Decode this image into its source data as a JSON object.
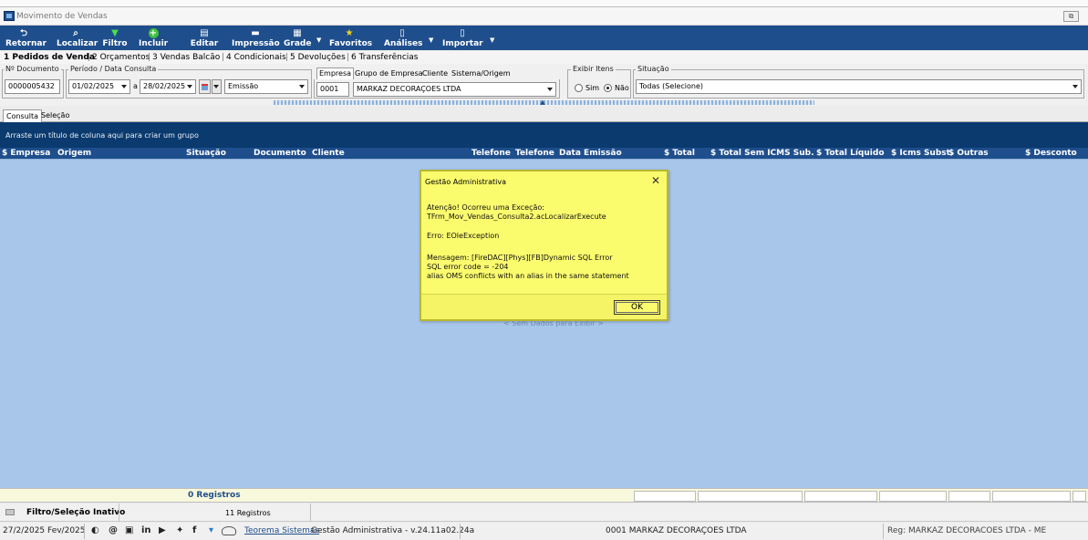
{
  "window": {
    "title": "Movimento de Vendas",
    "restore_glyph": "⧉"
  },
  "toolbar": {
    "buttons": [
      {
        "label": "Retornar",
        "icon": "return-arrow-icon",
        "glyph": "⮌"
      },
      {
        "label": "Localizar",
        "icon": "search-icon",
        "glyph": "⌕"
      },
      {
        "label": "Filtro",
        "icon": "filter-icon",
        "glyph": "▼"
      },
      {
        "label": "Incluir",
        "icon": "add-circle-icon",
        "glyph": "+"
      },
      {
        "label": "Editar",
        "icon": "edit-document-icon",
        "glyph": "▤"
      },
      {
        "label": "Impressão",
        "icon": "printer-icon",
        "glyph": "▬"
      },
      {
        "label": "Grade",
        "icon": "grid-icon",
        "glyph": "▦"
      },
      {
        "label": "Favoritos",
        "icon": "star-icon",
        "glyph": "★"
      },
      {
        "label": "Análises",
        "icon": "document-icon",
        "glyph": "▯"
      },
      {
        "label": "Importar",
        "icon": "document-import-icon",
        "glyph": "▯"
      }
    ],
    "drop_glyph": "▼"
  },
  "module_tabs": [
    "1 Pedidos de Venda",
    "2 Orçamentos",
    "3 Vendas Balcão",
    "4 Condicionais",
    "5 Devoluções",
    "6 Transferências"
  ],
  "module_tab_separator": "|",
  "filters": {
    "documento": {
      "label": "Nº Documento",
      "value": "0000005432"
    },
    "periodo": {
      "label": "Período / Data Consulta",
      "start": "01/02/2025",
      "connector": "a",
      "end": "28/02/2025",
      "type": "Emissão"
    },
    "empresa_tabs": [
      "Empresa",
      "Grupo de Empresa",
      "Cliente",
      "Sistema/Origem"
    ],
    "empresa": {
      "code": "0001",
      "name": "MARKAZ DECORAÇOES LTDA"
    },
    "exibir_itens": {
      "label": "Exibir Itens",
      "options": [
        "Sim",
        "Não"
      ],
      "selected": "Não"
    },
    "situacao": {
      "label": "Situação",
      "value": "Todas (Selecione)"
    },
    "collapse_glyph": "▲"
  },
  "consulta_tabs": [
    "Consulta",
    "Seleção"
  ],
  "grid": {
    "group_hint": "Arraste um título de coluna aqui para criar um grupo",
    "columns": [
      "$ Empresa",
      "Origem",
      "Situação",
      "Documento",
      "Cliente",
      "Telefone",
      "Telefone C",
      "Data Emissão",
      "$ Total",
      "$ Total Sem ICMS Sub.",
      "$ Total Líquido",
      "$ Icms Subst.",
      "$ Outras D",
      "$ Desconto"
    ],
    "empty_message": "< Sem Dados para Exibir >",
    "records_total": "0 Registros"
  },
  "status": {
    "filter_state": "Filtro/Seleção Inativo",
    "records": "11 Registros",
    "date": "27/2/2025 Fev/2025",
    "social_glyphs": [
      "◐",
      "@",
      "▣",
      "in",
      "▶",
      "✦",
      "f",
      "▾"
    ],
    "company_link": "Teorema Sistemas",
    "app_version": "Gestão Administrativa - v.24.11a02.24a",
    "company": "0001 MARKAZ DECORAÇOES LTDA",
    "registered": "Reg: MARKAZ DECORACOES LTDA - ME"
  },
  "dialog": {
    "title": "Gestão Administrativa",
    "close_glyph": "✕",
    "lines": [
      "Atenção! Ocorreu uma Exceção:",
      "TFrm_Mov_Vendas_Consulta2.acLocalizarExecute",
      "Erro: EOleException",
      " Mensagem: [FireDAC][Phys][FB]Dynamic SQL Error",
      "SQL error code = -204",
      "alias OMS conflicts with an alias in the same statement"
    ],
    "ok_label": "OK"
  },
  "colors": {
    "toolbar": "#1f4e8c",
    "grid_body": "#a8c6ea",
    "dialog_bg": "#fbfb6e"
  }
}
